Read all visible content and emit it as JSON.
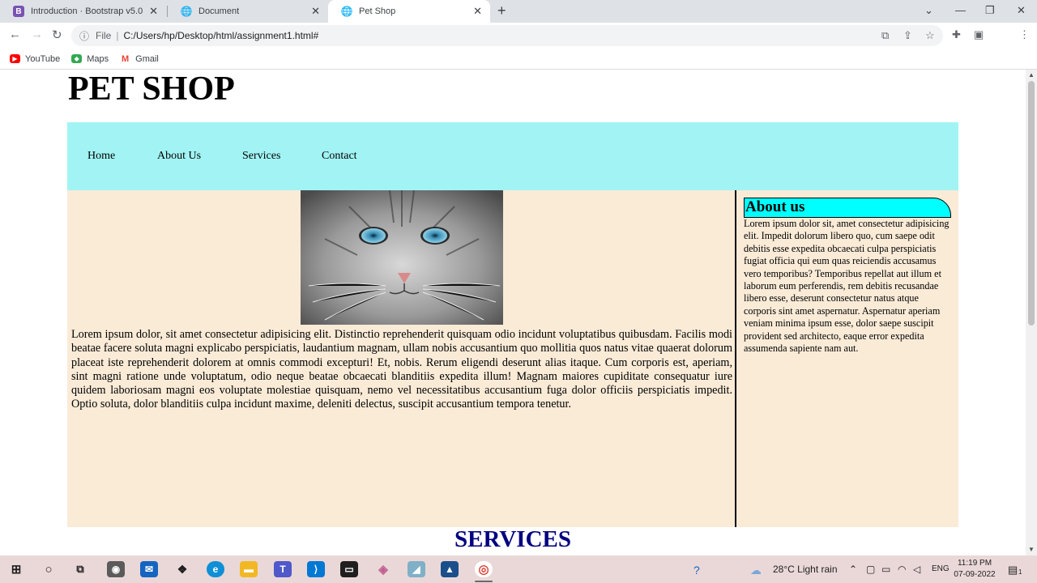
{
  "browser": {
    "tabs": [
      {
        "title": "Introduction · Bootstrap v5.0",
        "favicon_icon": "bootstrap-icon",
        "favicon_color": "#7952b3"
      },
      {
        "title": "Document",
        "favicon_icon": "globe-icon"
      },
      {
        "title": "Pet Shop",
        "favicon_icon": "globe-icon",
        "active": true
      }
    ],
    "address": {
      "scheme": "File",
      "url": "C:/Users/hp/Desktop/html/assignment1.html#"
    },
    "bookmarks": [
      {
        "label": "YouTube",
        "icon": "youtube-icon",
        "color": "#ff0000"
      },
      {
        "label": "Maps",
        "icon": "maps-icon",
        "color": "#34a853"
      },
      {
        "label": "Gmail",
        "icon": "gmail-icon",
        "color": "#ea4335"
      }
    ]
  },
  "page": {
    "title": "PET SHOP",
    "nav": [
      "Home",
      "About Us",
      "Services",
      "Contact"
    ],
    "main_text": "Lorem ipsum dolor, sit amet consectetur adipisicing elit. Distinctio reprehenderit quisquam odio incidunt voluptatibus quibusdam. Facilis modi beatae facere soluta magni explicabo perspiciatis, laudantium magnam, ullam nobis accusantium quo mollitia quos natus vitae quaerat dolorum placeat iste reprehenderit dolorem at omnis commodi excepturi! Et, nobis. Rerum eligendi deserunt alias itaque. Cum corporis est, aperiam, sint magni ratione unde voluptatum, odio neque beatae obcaecati blanditiis expedita illum! Magnam maiores cupiditate consequatur iure quidem laboriosam magni eos voluptate molestiae quisquam, nemo vel necessitatibus accusantium fuga dolor officiis perspiciatis impedit. Optio soluta, dolor blanditiis culpa incidunt maxime, deleniti delectus, suscipit accusantium tempora tenetur.",
    "about": {
      "heading": "About us",
      "text": "Lorem ipsum dolor sit, amet consectetur adipisicing elit. Impedit dolorum libero quo, cum saepe odit debitis esse expedita obcaecati culpa perspiciatis fugiat officia qui eum quas reiciendis accusamus vero temporibus? Temporibus repellat aut illum et laborum eum perferendis, rem debitis recusandae libero esse, deserunt consectetur natus atque corporis sint amet aspernatur. Aspernatur aperiam veniam minima ipsum esse, dolor saepe suscipit provident sed architecto, eaque error expedita assumenda sapiente nam aut."
    },
    "services_heading": "SERVICES",
    "colors": {
      "navbar": "#a2f4f4",
      "content_bg": "#faebd7",
      "about_heading_bg": "#00ffff",
      "services_heading": "#000080"
    }
  },
  "taskbar": {
    "weather": "28°C  Light rain",
    "language": "ENG",
    "time": "11:19 PM",
    "date": "07-09-2022",
    "notification_count": "1"
  }
}
